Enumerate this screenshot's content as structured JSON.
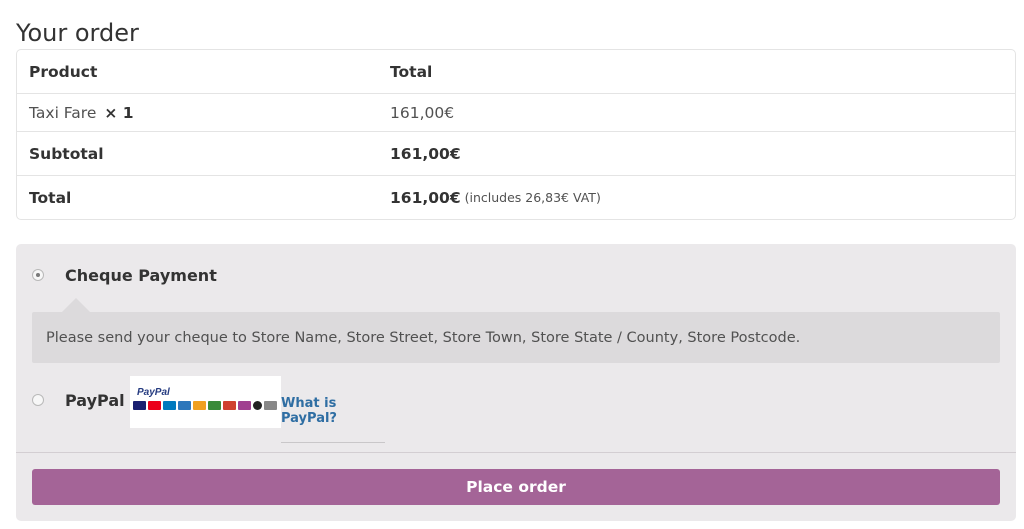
{
  "title": "Your order",
  "table": {
    "headers": [
      "Product",
      "Total"
    ],
    "item": {
      "name": "Taxi Fare",
      "qty": "× 1",
      "total": "161,00€"
    },
    "subtotal": {
      "label": "Subtotal",
      "value": "161,00€"
    },
    "total": {
      "label": "Total",
      "value": "161,00€",
      "note": "(includes 26,83€ VAT)"
    }
  },
  "payment": {
    "methods": [
      {
        "label": "Cheque Payment",
        "selected": true,
        "description": "Please send your cheque to Store Name, Store Street, Store Town, Store State / County, Store Postcode."
      },
      {
        "label": "PayPal",
        "selected": false,
        "logo_text": "PayPal",
        "link": "What is PayPal?"
      }
    ],
    "place_order": "Place order"
  },
  "colors": {
    "accent": "#a46497",
    "link": "#2f6ea3",
    "panel": "#ebe9eb"
  }
}
